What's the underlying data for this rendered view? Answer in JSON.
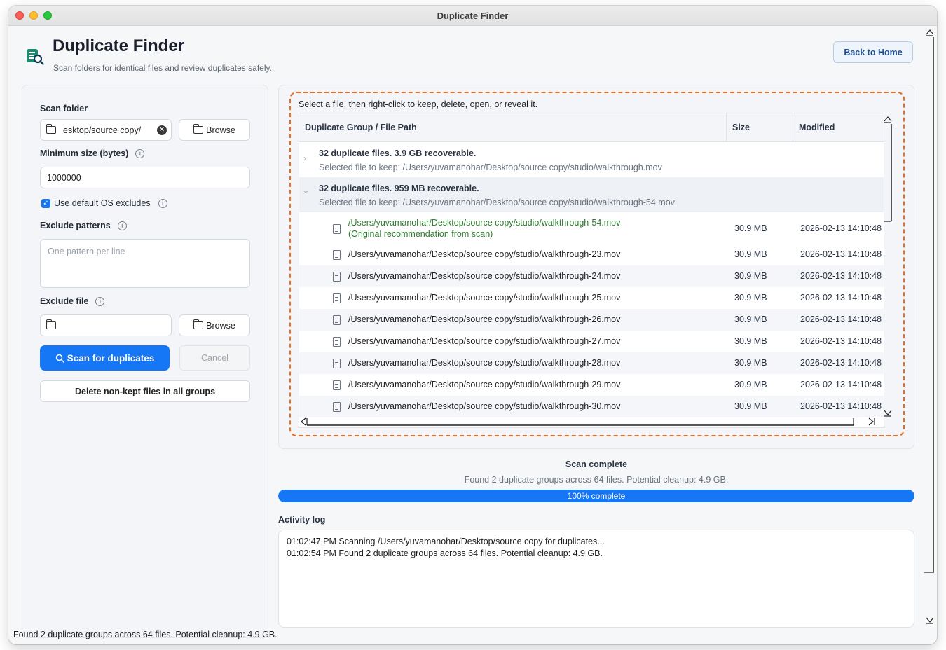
{
  "window": {
    "title": "Duplicate Finder"
  },
  "header": {
    "title": "Duplicate Finder",
    "subtitle": "Scan folders for identical files and review duplicates safely.",
    "back_label": "Back to Home"
  },
  "left": {
    "scan_folder_label": "Scan folder",
    "scan_folder_value": "esktop/source copy/",
    "browse_label": "Browse",
    "min_size_label": "Minimum size (bytes)",
    "min_size_value": "1000000",
    "default_excludes_label": "Use default OS excludes",
    "default_excludes_checked": true,
    "exclude_patterns_label": "Exclude patterns",
    "exclude_patterns_placeholder": "One pattern per line",
    "exclude_file_label": "Exclude file",
    "exclude_file_value": "",
    "browse2_label": "Browse",
    "scan_label": "Scan for duplicates",
    "cancel_label": "Cancel",
    "delete_label": "Delete non-kept files in all groups"
  },
  "results": {
    "hint": "Select a file, then right-click to keep, delete, open, or reveal it.",
    "columns": [
      "Duplicate Group / File Path",
      "Size",
      "Modified"
    ],
    "groups": [
      {
        "title": "32 duplicate files. 3.9 GB recoverable.",
        "keep": "Selected file to keep: /Users/yuvamanohar/Desktop/source copy/studio/walkthrough.mov",
        "expanded": false
      },
      {
        "title": "32 duplicate files. 959 MB recoverable.",
        "keep": "Selected file to keep: /Users/yuvamanohar/Desktop/source copy/studio/walkthrough-54.mov",
        "expanded": true
      }
    ],
    "files": [
      {
        "path": "/Users/yuvamanohar/Desktop/source copy/studio/walkthrough-54.mov",
        "note": "(Original recommendation from scan)",
        "size": "30.9 MB",
        "modified": "2026-02-13 14:10:48",
        "kept": true
      },
      {
        "path": "/Users/yuvamanohar/Desktop/source copy/studio/walkthrough-23.mov",
        "size": "30.9 MB",
        "modified": "2026-02-13 14:10:48"
      },
      {
        "path": "/Users/yuvamanohar/Desktop/source copy/studio/walkthrough-24.mov",
        "size": "30.9 MB",
        "modified": "2026-02-13 14:10:48"
      },
      {
        "path": "/Users/yuvamanohar/Desktop/source copy/studio/walkthrough-25.mov",
        "size": "30.9 MB",
        "modified": "2026-02-13 14:10:48"
      },
      {
        "path": "/Users/yuvamanohar/Desktop/source copy/studio/walkthrough-26.mov",
        "size": "30.9 MB",
        "modified": "2026-02-13 14:10:48"
      },
      {
        "path": "/Users/yuvamanohar/Desktop/source copy/studio/walkthrough-27.mov",
        "size": "30.9 MB",
        "modified": "2026-02-13 14:10:48"
      },
      {
        "path": "/Users/yuvamanohar/Desktop/source copy/studio/walkthrough-28.mov",
        "size": "30.9 MB",
        "modified": "2026-02-13 14:10:48"
      },
      {
        "path": "/Users/yuvamanohar/Desktop/source copy/studio/walkthrough-29.mov",
        "size": "30.9 MB",
        "modified": "2026-02-13 14:10:48"
      },
      {
        "path": "/Users/yuvamanohar/Desktop/source copy/studio/walkthrough-30.mov",
        "size": "30.9 MB",
        "modified": "2026-02-13 14:10:48"
      }
    ]
  },
  "status": {
    "title": "Scan complete",
    "summary": "Found 2 duplicate groups across 64 files. Potential cleanup: 4.9 GB.",
    "progress_percent": 100,
    "progress_label": "100% complete"
  },
  "log": {
    "label": "Activity log",
    "entries": [
      "01:02:47 PM  Scanning /Users/yuvamanohar/Desktop/source copy for duplicates...",
      "01:02:54 PM  Found 2 duplicate groups across 64 files. Potential cleanup: 4.9 GB."
    ]
  },
  "footer": {
    "status": "Found 2 duplicate groups across 64 files. Potential cleanup: 4.9 GB."
  },
  "colors": {
    "accent": "#1677f6",
    "highlight": "#ec6c1f",
    "kept_text": "#2b7a2b"
  },
  "icons": {
    "app": "duplicate-finder-icon",
    "folder": "folder-icon",
    "browse": "folder-open-icon",
    "clear": "clear-icon",
    "info": "info-icon",
    "search": "search-icon",
    "file": "document-icon",
    "chevron_right": "chevron-right-icon",
    "chevron_down": "chevron-down-icon"
  }
}
